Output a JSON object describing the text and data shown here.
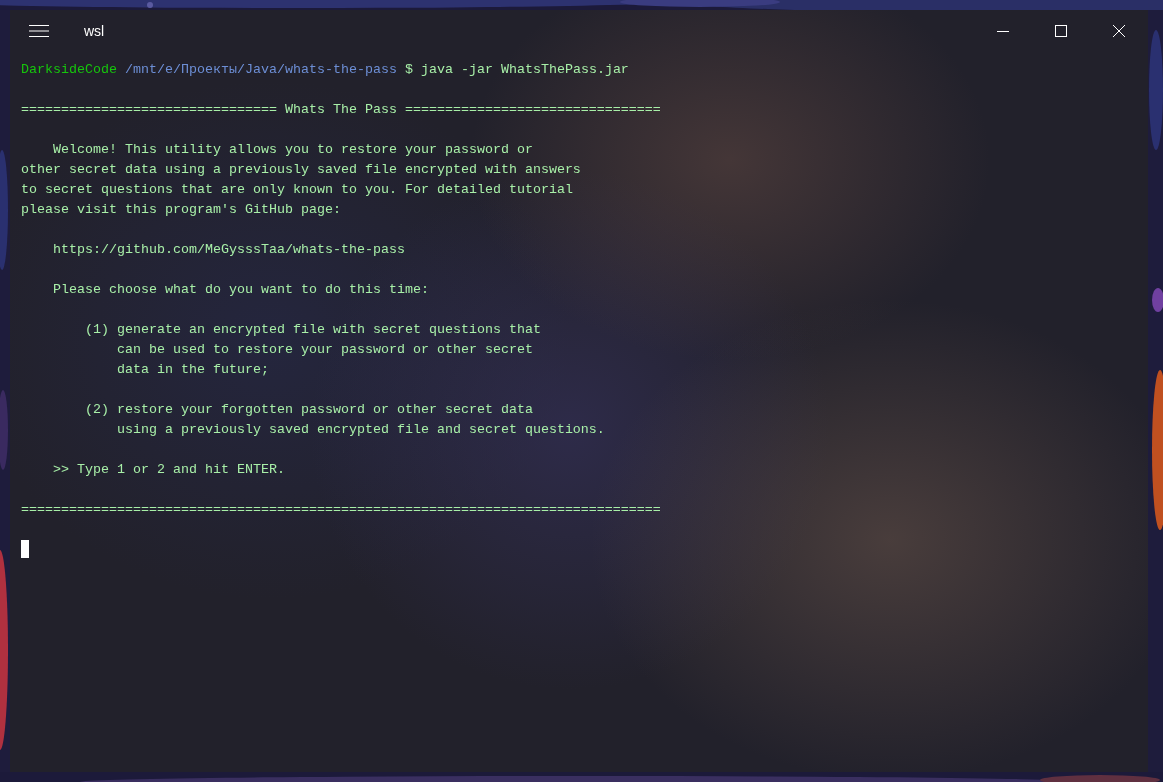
{
  "window": {
    "title": "wsl"
  },
  "prompt": {
    "user": "DarksideCode",
    "path": "/mnt/e/Проекты/Java/whats-the-pass",
    "symbol": "$",
    "command": "java -jar WhatsThePass.jar"
  },
  "output_blocks": [
    {
      "lines": [
        "================================ Whats The Pass ================================"
      ]
    },
    {
      "lines": [
        "    Welcome! This utility allows you to restore your password or",
        "other secret data using a previously saved file encrypted with answers",
        "to secret questions that are only known to you. For detailed tutorial",
        "please visit this program's GitHub page:"
      ]
    },
    {
      "lines": [
        "    https://github.com/MeGysssTaa/whats-the-pass"
      ]
    },
    {
      "lines": [
        "    Please choose what do you want to do this time:"
      ]
    },
    {
      "lines": [
        "        (1) generate an encrypted file with secret questions that",
        "            can be used to restore your password or other secret",
        "            data in the future;"
      ]
    },
    {
      "lines": [
        "        (2) restore your forgotten password or other secret data",
        "            using a previously saved encrypted file and secret questions."
      ]
    },
    {
      "lines": [
        "    >> Type 1 or 2 and hit ENTER."
      ]
    },
    {
      "lines": [
        "================================================================================"
      ]
    }
  ],
  "cursor_visible": true
}
